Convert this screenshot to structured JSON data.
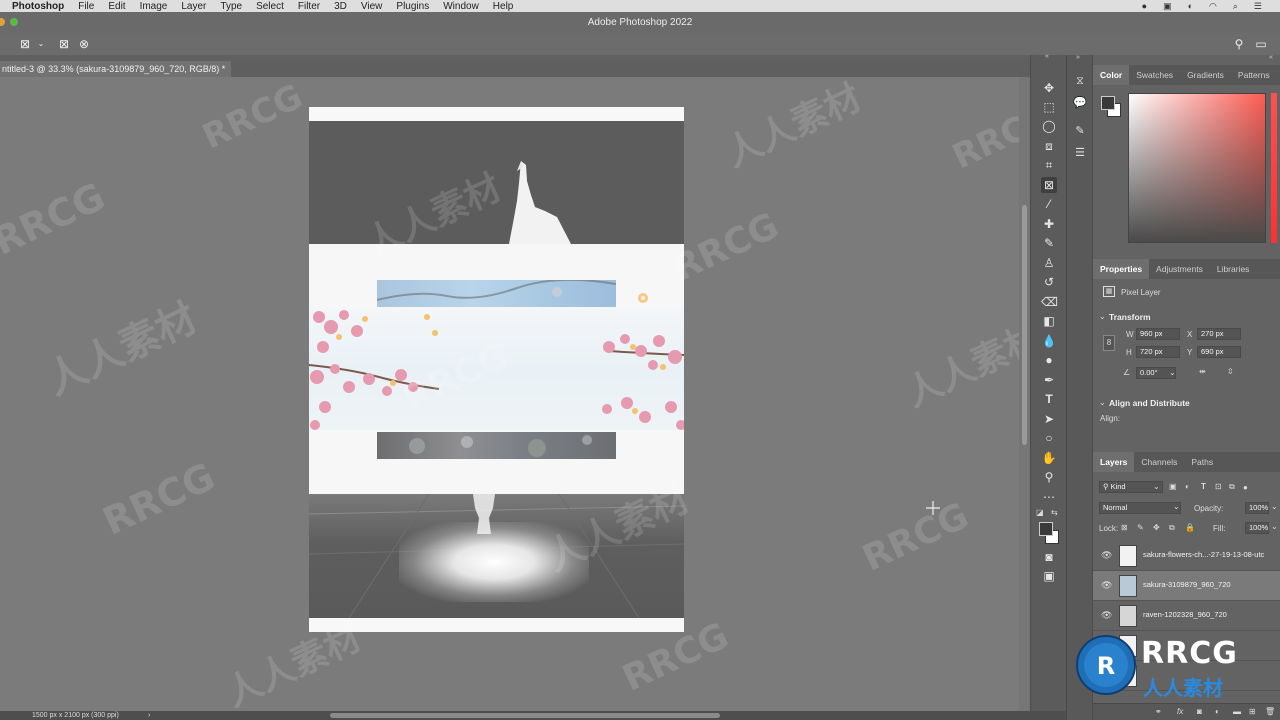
{
  "menubar": {
    "items": [
      "Photoshop",
      "File",
      "Edit",
      "Image",
      "Layer",
      "Type",
      "Select",
      "Filter",
      "3D",
      "View",
      "Plugins",
      "Window",
      "Help"
    ]
  },
  "window": {
    "title": "Adobe Photoshop 2022"
  },
  "document": {
    "tab_label": "ntitled-3 @ 33.3% (sakura-3109879_960_720, RGB/8) *",
    "status": "1500 px x 2100 px (300 ppi)"
  },
  "color_panel": {
    "tabs": [
      "Color",
      "Swatches",
      "Gradients",
      "Patterns"
    ],
    "active_tab": "Color",
    "colors": {
      "foreground": "#3a3a3a",
      "background": "#ffffff",
      "field_hue": "#ff5a52"
    }
  },
  "properties_panel": {
    "tabs": [
      "Properties",
      "Adjustments",
      "Libraries"
    ],
    "active_tab": "Properties",
    "layer_type": "Pixel Layer",
    "transform": {
      "heading": "Transform",
      "w_label": "W",
      "w_value": "960 px",
      "h_label": "H",
      "h_value": "720 px",
      "x_label": "X",
      "x_value": "270 px",
      "y_label": "Y",
      "y_value": "690 px",
      "angle": "0.00°"
    },
    "align": {
      "heading": "Align and Distribute",
      "label": "Align:"
    }
  },
  "layers_panel": {
    "tabs": [
      "Layers",
      "Channels",
      "Paths"
    ],
    "active_tab": "Layers",
    "filter": "Kind",
    "blend_mode": "Normal",
    "opacity_label": "Opacity:",
    "opacity": "100%",
    "lock_label": "Lock:",
    "fill_label": "Fill:",
    "fill": "100%",
    "layers": [
      {
        "name": "sakura-flowers-ch...-27-19-13-08-utc",
        "selected": false
      },
      {
        "name": "sakura-3109879_960_720",
        "selected": true
      },
      {
        "name": "raven-1202328_960_720",
        "selected": false
      }
    ]
  },
  "watermark": {
    "latin": "RRCG",
    "cjk": "人人素材"
  },
  "logo": {
    "title": "RRCG",
    "subtitle": "人人素材"
  }
}
